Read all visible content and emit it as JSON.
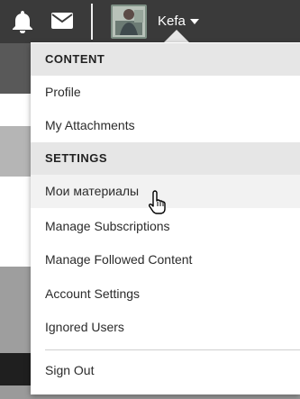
{
  "header": {
    "username": "Kefa",
    "icons": {
      "notifications": "bell-icon",
      "messages": "envelope-icon",
      "user_menu_caret": "caret-down-icon"
    }
  },
  "menu": {
    "sections": [
      {
        "label": "CONTENT",
        "items": [
          "Profile",
          "My Attachments"
        ]
      },
      {
        "label": "SETTINGS",
        "items": [
          "Мои материалы",
          "Manage Subscriptions",
          "Manage Followed Content",
          "Account Settings",
          "Ignored Users"
        ]
      }
    ],
    "sign_out": "Sign Out",
    "hovered_item": "Мои материалы"
  },
  "colors": {
    "topbar": "#3a3a3a",
    "section_bg": "#e6e6e6",
    "hover_bg": "#f2f2f2",
    "text": "#2b2b2b"
  }
}
